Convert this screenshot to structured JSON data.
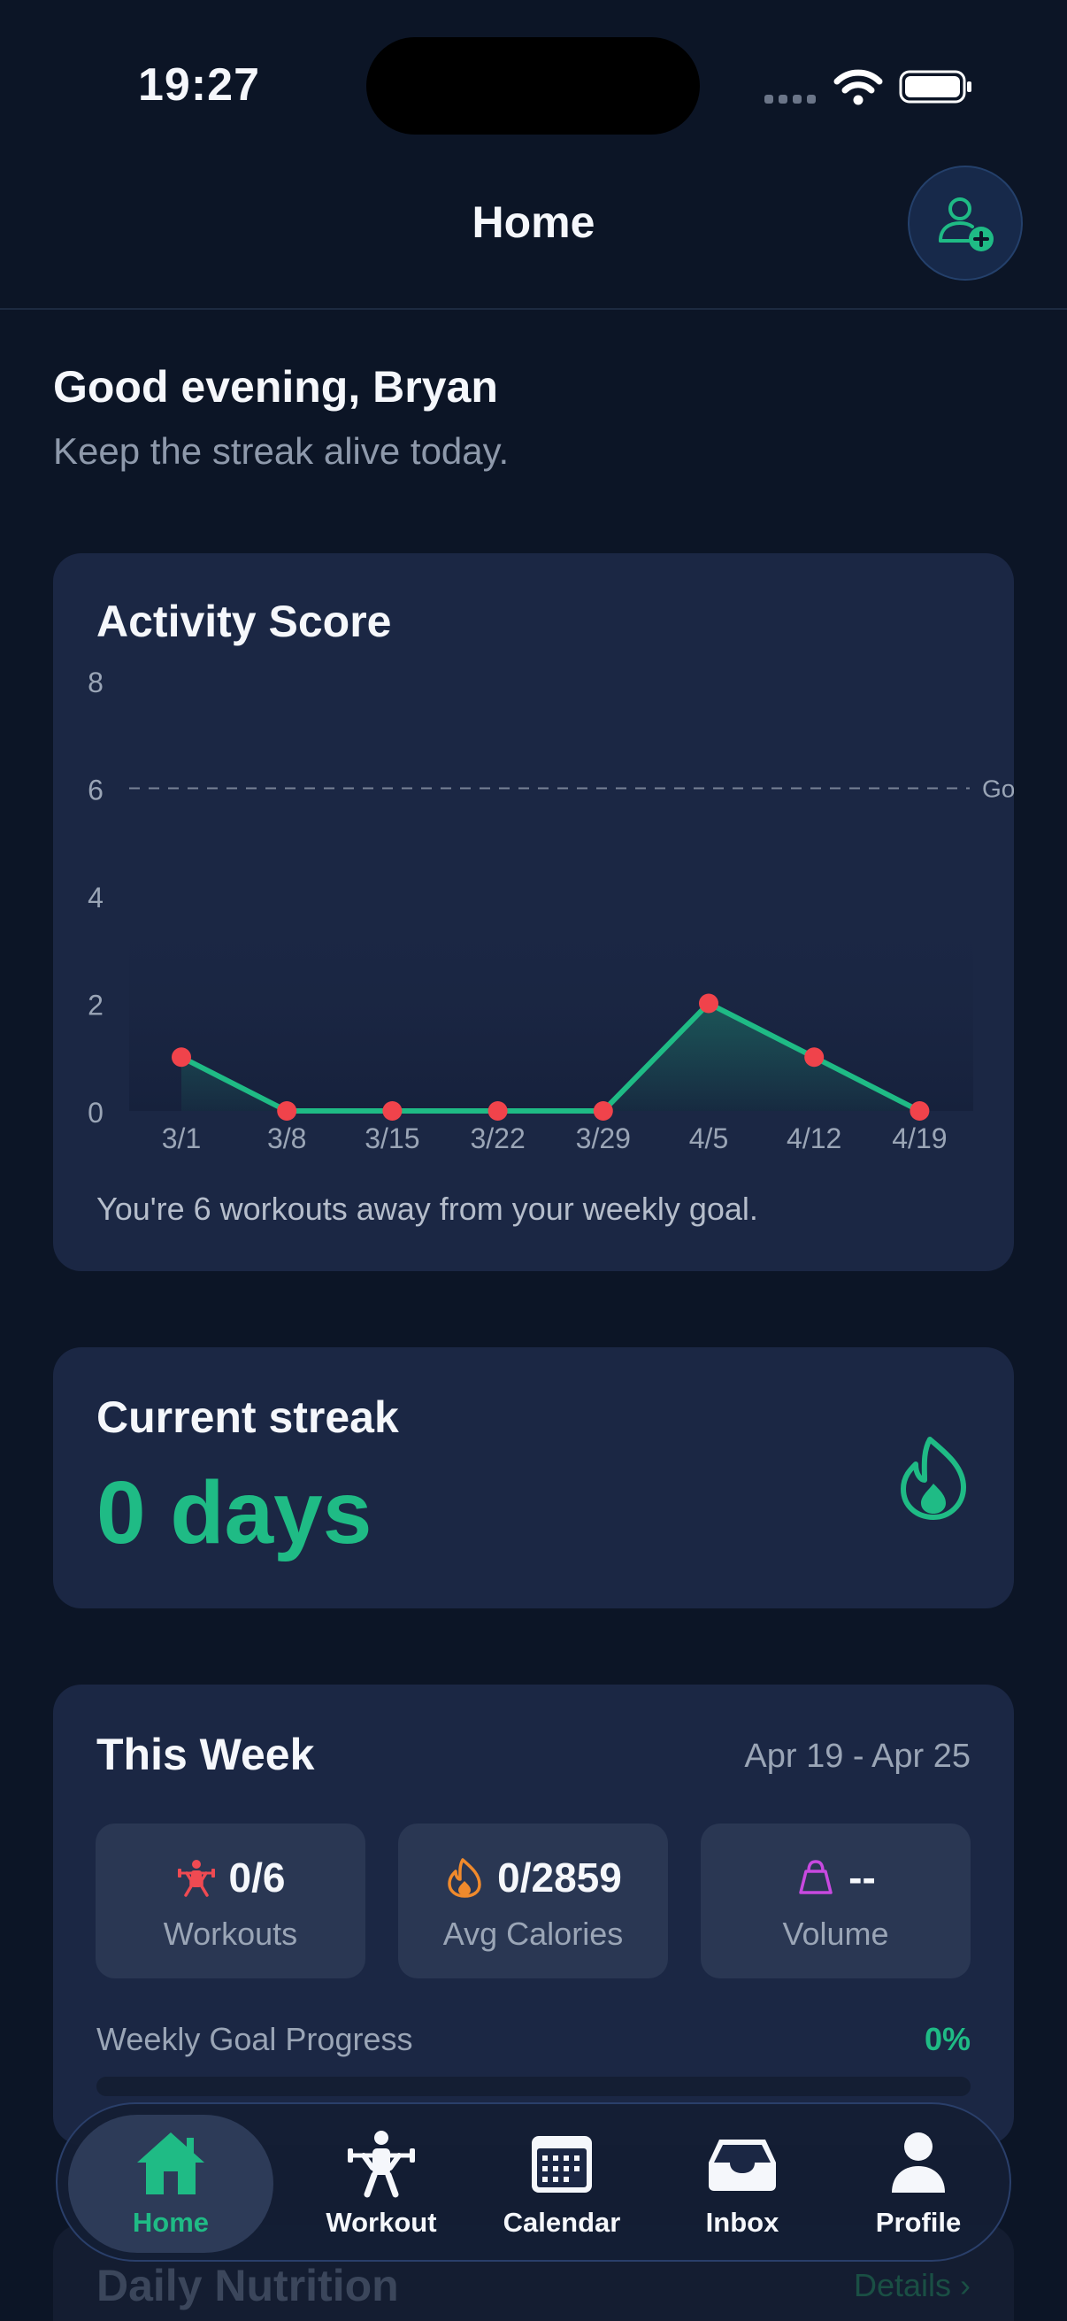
{
  "status_bar": {
    "time": "19:27"
  },
  "header": {
    "title": "Home",
    "action_icon": "add-person-icon"
  },
  "greeting": {
    "title": "Good evening, Bryan",
    "subtitle": "Keep the streak alive today."
  },
  "activity": {
    "title": "Activity Score",
    "note": "You're 6 workouts away from your weekly goal.",
    "goal_label": "Go"
  },
  "chart_data": {
    "type": "line",
    "title": "Activity Score",
    "x": [
      "3/1",
      "3/8",
      "3/15",
      "3/22",
      "3/29",
      "4/5",
      "4/12",
      "4/19"
    ],
    "values": [
      1,
      0,
      0,
      0,
      0,
      2,
      1,
      0
    ],
    "ylim": [
      0,
      8
    ],
    "yticks": [
      0,
      2,
      4,
      6,
      8
    ],
    "goal_line": 6,
    "goal_label": "Go",
    "grid": false,
    "colors": {
      "line": "#1fbb85",
      "point": "#f0434b",
      "goal": "#8e99ab"
    }
  },
  "streak": {
    "title": "Current streak",
    "value": "0 days",
    "icon": "flame-icon"
  },
  "week": {
    "title": "This Week",
    "range": "Apr 19 - Apr 25",
    "stats": [
      {
        "icon": "lifter-icon",
        "value": "0/6",
        "label": "Workouts",
        "color": "#ef4a52"
      },
      {
        "icon": "flame-small-icon",
        "value": "0/2859",
        "label": "Avg Calories",
        "color": "#f08a2c"
      },
      {
        "icon": "kettlebell-icon",
        "value": "--",
        "label": "Volume",
        "color": "#c849e0"
      }
    ],
    "goal_label": "Weekly Goal Progress",
    "goal_percent_text": "0%",
    "goal_progress": 0
  },
  "nutrition": {
    "title": "Daily Nutrition",
    "details": "Details ›"
  },
  "tabs": [
    {
      "label": "Home",
      "icon": "home-icon",
      "active": true
    },
    {
      "label": "Workout",
      "icon": "workout-icon",
      "active": false
    },
    {
      "label": "Calendar",
      "icon": "calendar-icon",
      "active": false
    },
    {
      "label": "Inbox",
      "icon": "inbox-icon",
      "active": false
    },
    {
      "label": "Profile",
      "icon": "profile-icon",
      "active": false
    }
  ],
  "colors": {
    "accent": "#1fbb85",
    "background": "#0c1526",
    "card": "#1b2744"
  }
}
